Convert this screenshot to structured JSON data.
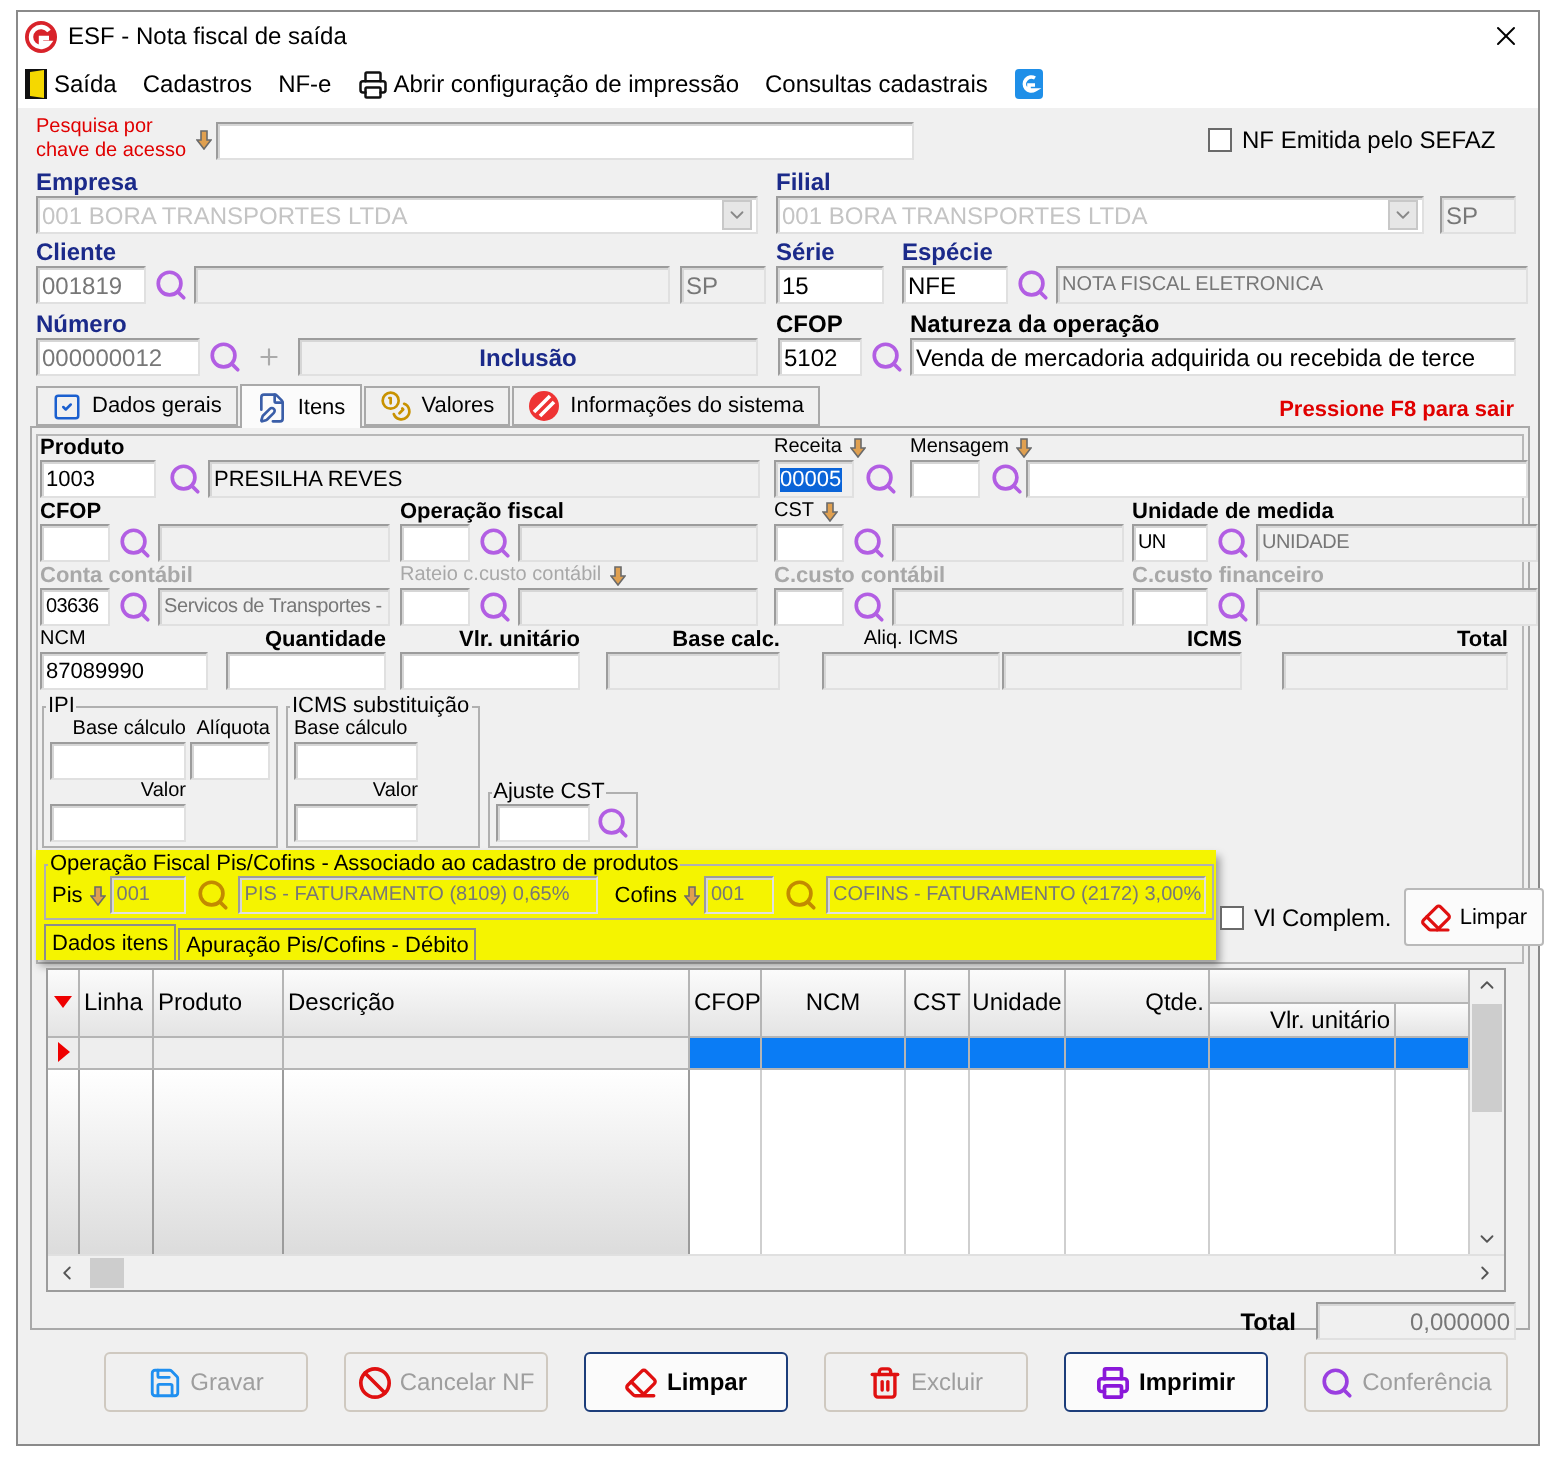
{
  "window": {
    "title": "ESF - Nota fiscal de saída"
  },
  "menu": [
    {
      "label": "Saída",
      "kind": "exit"
    },
    {
      "label": "Cadastros",
      "kind": "plain"
    },
    {
      "label": "NF-e",
      "kind": "plain"
    },
    {
      "label": "Abrir configuração de impressão",
      "kind": "print"
    },
    {
      "label": "Consultas cadastrais",
      "kind": "plain"
    },
    {
      "kind": "logo"
    }
  ],
  "access_key_search": {
    "label": "Pesquisa por chave de acesso"
  },
  "nf_sefaz": {
    "label": "NF Emitida pelo SEFAZ",
    "checked": false
  },
  "empresa": {
    "label": "Empresa",
    "value": "001 BORA TRANSPORTES LTDA"
  },
  "filial": {
    "label": "Filial",
    "value": "001 BORA TRANSPORTES LTDA",
    "uf": "SP"
  },
  "cliente": {
    "label": "Cliente",
    "code": "001819",
    "uf": "SP"
  },
  "serie": {
    "label": "Série",
    "value": "15"
  },
  "especie": {
    "label": "Espécie",
    "code": "NFE",
    "description": "NOTA FISCAL ELETRONICA"
  },
  "numero": {
    "label": "Número",
    "value": "000000012",
    "status": "Inclusão"
  },
  "cfop": {
    "label": "CFOP",
    "value": "5102"
  },
  "natureza": {
    "label": "Natureza da operação",
    "value": "Venda de mercadoria adquirida ou recebida de terce"
  },
  "tabs": [
    {
      "label": "Dados gerais",
      "selected": false
    },
    {
      "label": "Itens",
      "selected": true
    },
    {
      "label": "Valores",
      "selected": false
    },
    {
      "label": "Informações do sistema",
      "selected": false
    }
  ],
  "exit_hint": "Pressione F8 para sair",
  "produto": {
    "label": "Produto",
    "code": "1003",
    "description": "PRESILHA REVES"
  },
  "receita": {
    "label": "Receita",
    "value": "00005",
    "selected": true
  },
  "mensagem": {
    "label": "Mensagem"
  },
  "lookup_rows": [
    [
      {
        "label": "CFOP",
        "required": true,
        "disabled": false,
        "arrow": false
      },
      {
        "label": "Operação fiscal",
        "required": true,
        "disabled": false,
        "arrow": false
      },
      {
        "label": "CST",
        "required": false,
        "disabled": false,
        "arrow": true
      },
      {
        "label": "Unidade de medida",
        "required": true,
        "disabled": false,
        "arrow": false,
        "code": "UN",
        "description": "UNIDADE"
      }
    ],
    [
      {
        "label": "Conta contábil",
        "required": true,
        "disabled": true,
        "arrow": false,
        "code": "03636",
        "description": "Servicos de Transportes -"
      },
      {
        "label": "Rateio c.custo contábil",
        "required": false,
        "disabled": true,
        "arrow": true
      },
      {
        "label": "C.custo contábil",
        "required": true,
        "disabled": true,
        "arrow": false
      },
      {
        "label": "C.custo financeiro",
        "required": true,
        "disabled": true,
        "arrow": false
      }
    ]
  ],
  "values": [
    {
      "label": "NCM",
      "value": "87089990",
      "required": false,
      "readonly": false
    },
    {
      "label": "Quantidade",
      "required": true,
      "readonly": false
    },
    {
      "label": "Vlr. unitário",
      "required": true,
      "readonly": false
    },
    {
      "label": "Base calc.",
      "required": true,
      "readonly": true
    },
    {
      "label": "Aliq. ICMS",
      "required": false,
      "readonly": true
    },
    {
      "label": "ICMS",
      "required": true,
      "readonly": true
    },
    {
      "label": "Total",
      "required": true,
      "readonly": true
    }
  ],
  "ipi": {
    "title": "IPI",
    "fields": [
      "Base cálculo",
      "Alíquota",
      "Valor"
    ]
  },
  "icms_st": {
    "title": "ICMS substituição",
    "fields": [
      "Base cálculo",
      "Valor"
    ]
  },
  "ajuste_cst": {
    "title": "Ajuste CST"
  },
  "pis_cofins": {
    "title": "Operação Fiscal Pis/Cofins - Associado ao cadastro de produtos",
    "highlighted": true,
    "items": [
      {
        "label": "Pis",
        "code": "001",
        "description": "PIS - FATURAMENTO (8109) 0,65%"
      },
      {
        "label": "Cofins",
        "code": "001",
        "description": "COFINS - FATURAMENTO (2172) 3,00%"
      }
    ]
  },
  "item_tabs": [
    {
      "label": "Dados itens",
      "selected": true
    },
    {
      "label": "Apuração Pis/Cofins - Débito",
      "selected": false
    }
  ],
  "vl_complem": {
    "label": "Vl Complem.",
    "checked": false
  },
  "clear_item_button": {
    "label": "Limpar"
  },
  "grid": {
    "columns": [
      "Linha",
      "Produto",
      "Descrição",
      "CFOP",
      "NCM",
      "CST",
      "Unidade",
      "Qtde.",
      "Vlr. unitário"
    ],
    "rows": [
      {
        "selected": true
      }
    ]
  },
  "total": {
    "label": "Total",
    "value": "0,000000"
  },
  "buttons": [
    {
      "label": "Gravar",
      "disabled": true
    },
    {
      "label": "Cancelar NF",
      "disabled": true
    },
    {
      "label": "Limpar",
      "disabled": false
    },
    {
      "label": "Excluir",
      "disabled": true
    },
    {
      "label": "Imprimir",
      "disabled": false
    },
    {
      "label": "Conferência",
      "disabled": true
    }
  ]
}
